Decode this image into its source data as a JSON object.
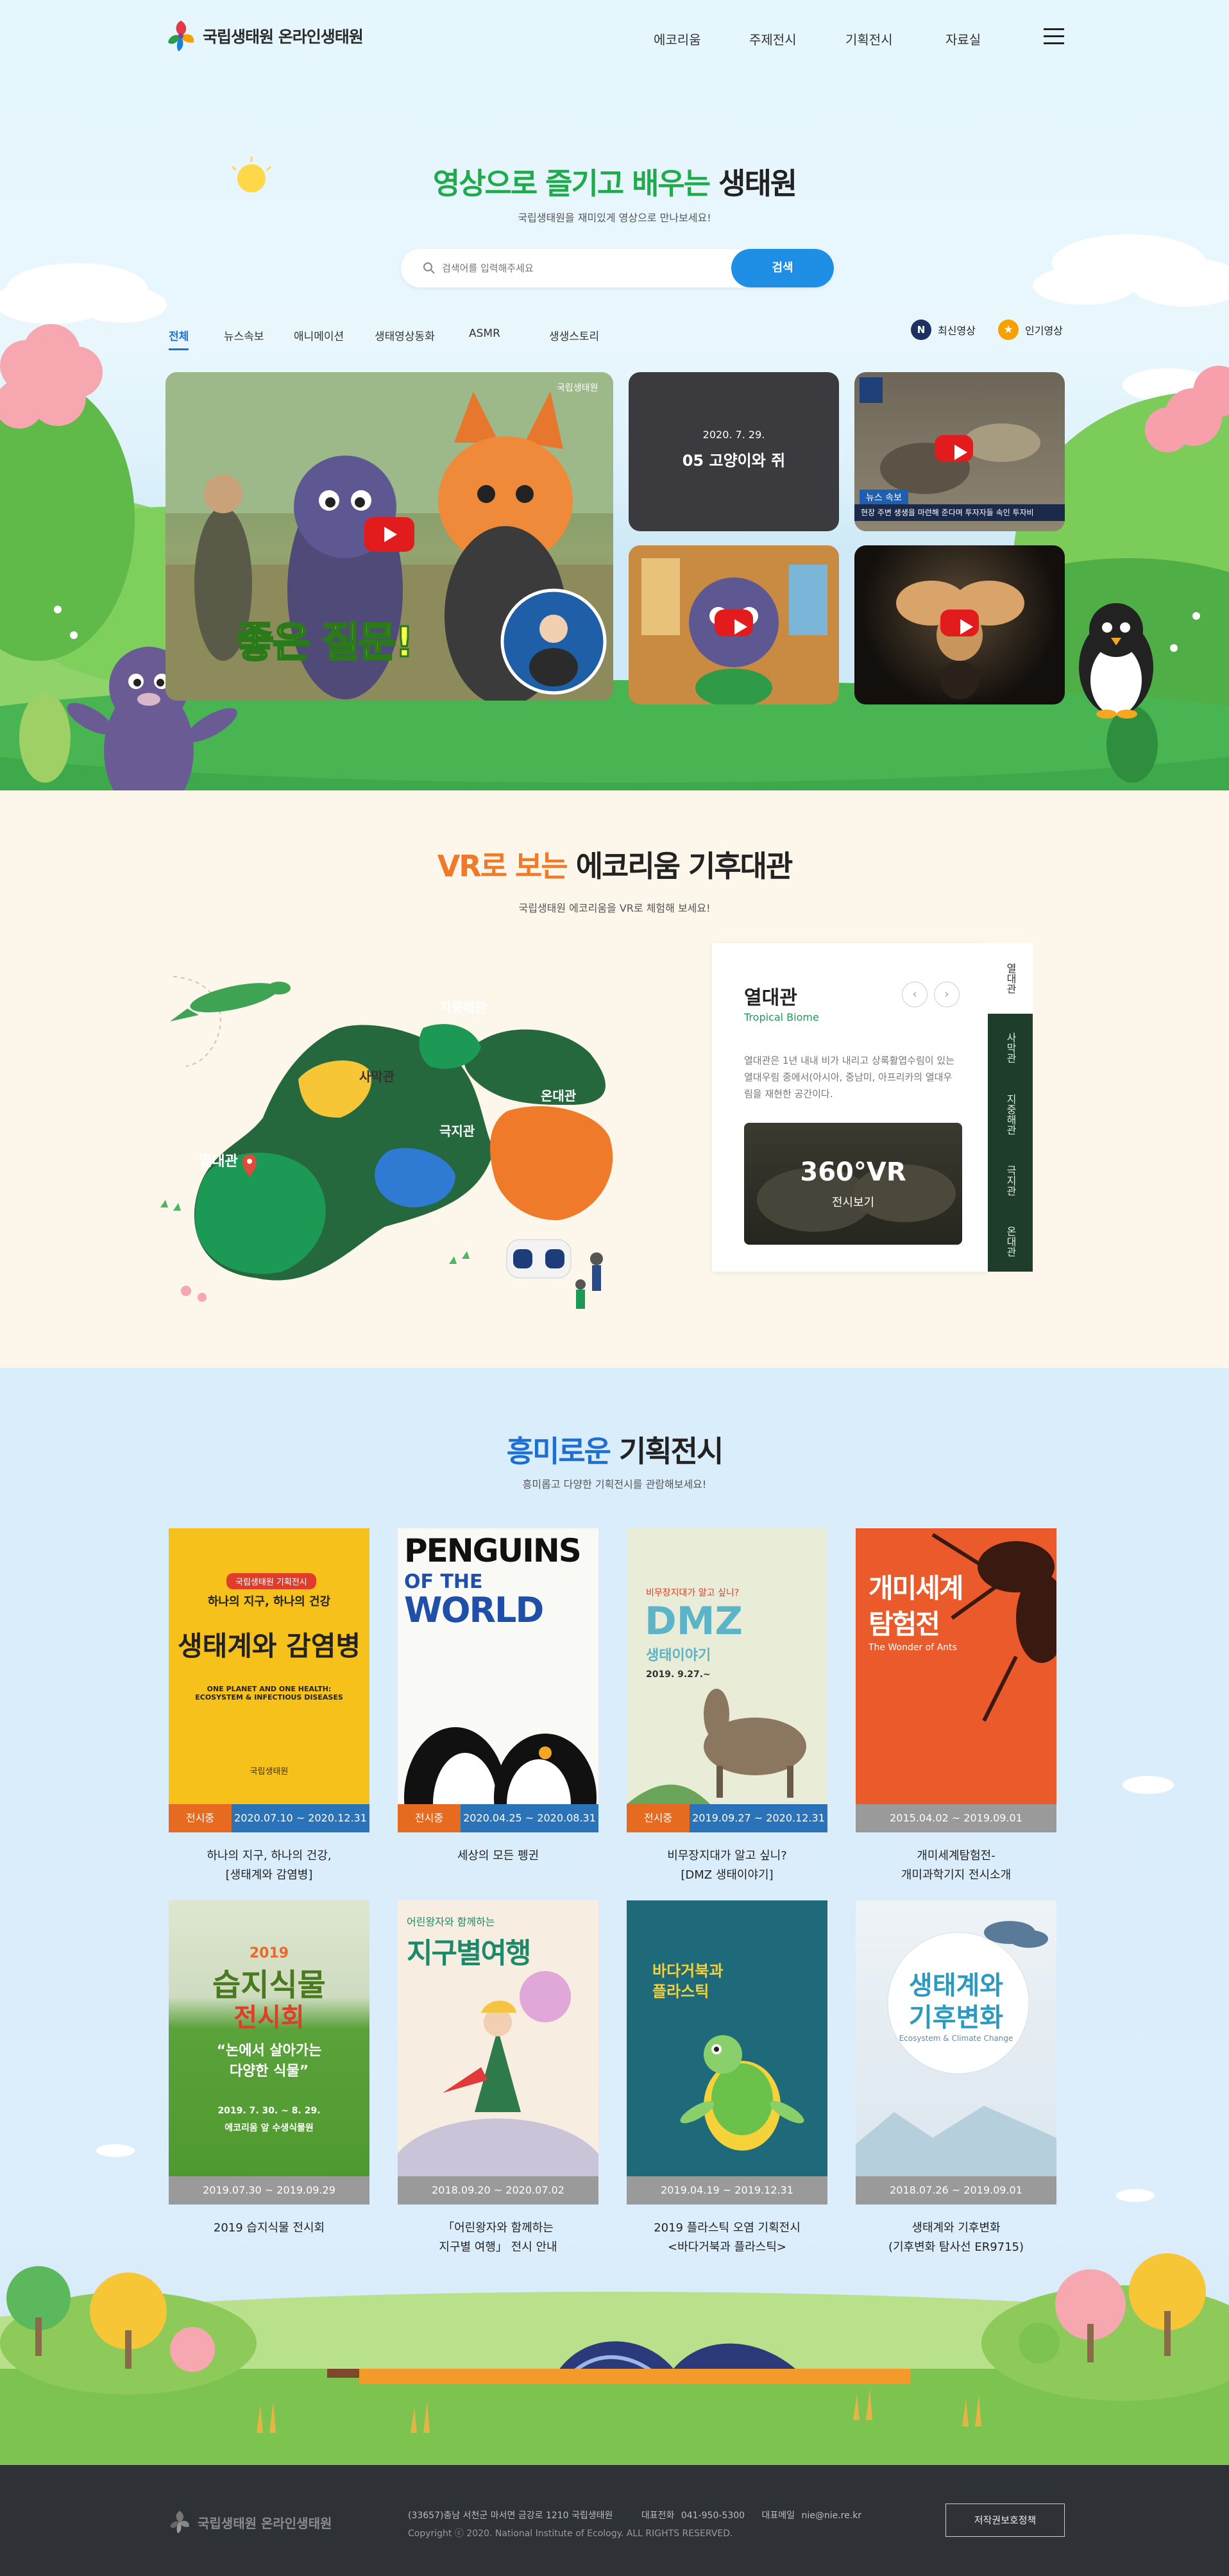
{
  "header": {
    "logo_text": "국립생태원 온라인생태원",
    "nav": [
      "에코리움",
      "주제전시",
      "기획전시",
      "자료실"
    ]
  },
  "video": {
    "title_highlight": "영상으로 즐기고 배우는",
    "title_rest": "생태원",
    "subtitle": "국립생태원을 재미있게 영상으로 만나보세요!",
    "search_placeholder": "검색어를 입력해주세요",
    "search_button": "검색",
    "tabs": [
      "전체",
      "뉴스속보",
      "애니메이션",
      "생태영상동화",
      "ASMR",
      "생생스토리"
    ],
    "sort_latest_badge": "N",
    "sort_latest": "최신영상",
    "sort_popular": "인기영상",
    "main_caption": "좋은 질문!",
    "main_watermark": "국립생태원",
    "card2_date": "2020. 7. 29.",
    "card2_title": "05 고양이와 쥐",
    "card3_tag": "뉴스 속보",
    "card3_caption": "현장 주변 생생을 마련해 준다며 투자자들 속인 투자비"
  },
  "vr": {
    "title_highlight": "VR로 보는",
    "title_rest": "에코리움 기후대관",
    "subtitle": "국립생태원 에코리움을 VR로 체험해 보세요!",
    "zones": [
      "지중해관",
      "사막관",
      "온대관",
      "극지관",
      "열대관"
    ],
    "panel_title": "열대관",
    "panel_en": "Tropical Biome",
    "panel_desc": "열대관은 1년 내내 비가 내리고 상록활엽수림이 있는 열대우림 중에서(아시아, 중남미, 아프리카의 열대우림을 재현한 공간이다.",
    "vr_button_big": "360°VR",
    "vr_button_small": "전시보기",
    "side_tabs": [
      "열대관",
      "사막관",
      "지중해관",
      "극지관",
      "온대관"
    ]
  },
  "exhibit": {
    "title_highlight": "흥미로운",
    "title_rest": "기획전시",
    "subtitle": "흥미롭고 다양한 기획전시를 관람해보세요!",
    "status_label": "전시중",
    "items": [
      {
        "date": "2020.07.10 ~ 2020.12.31",
        "caption1": "하나의 지구, 하나의 건강,",
        "caption2": "[생태계와 감염병]",
        "status": "전시중",
        "bar": "#2b73b8"
      },
      {
        "date": "2020.04.25 ~ 2020.08.31",
        "caption1": "세상의 모든 펭귄",
        "caption2": "",
        "status": "전시중",
        "bar": "#2b73b8"
      },
      {
        "date": "2019.09.27 ~ 2020.12.31",
        "caption1": "비무장지대가 알고 싶니?",
        "caption2": "[DMZ 생태이야기]",
        "status": "전시중",
        "bar": "#2b73b8"
      },
      {
        "date": "2015.04.02 ~ 2019.09.01",
        "caption1": "개미세계탐험전-",
        "caption2": "개미과학기지 전시소개",
        "status": "",
        "bar": "#9a9a9a"
      },
      {
        "date": "2019.07.30 ~ 2019.09.29",
        "caption1": "2019 습지식물 전시회",
        "caption2": "",
        "status": "",
        "bar": "#9a9a9a"
      },
      {
        "date": "2018.09.20 ~ 2020.07.02",
        "caption1": "「어린왕자와 함께하는",
        "caption2": "지구별 여행」 전시 안내",
        "status": "",
        "bar": "#9a9a9a"
      },
      {
        "date": "2019.04.19 ~ 2019.12.31",
        "caption1": "2019 플라스틱 오염 기획전시",
        "caption2": "<바다거북과 플라스틱>",
        "status": "",
        "bar": "#9a9a9a"
      },
      {
        "date": "2018.07.26 ~ 2019.09.01",
        "caption1": "생태계와 기후변화",
        "caption2": "(기후변화 탐사선 ER9715)",
        "status": "",
        "bar": "#9a9a9a"
      }
    ],
    "poster_texts": {
      "p1_top": "국립생태원 기획전시",
      "p1_head": "하나의 지구, 하나의 건강",
      "p1_big": "생태계와 감염병",
      "p1_en": "ONE PLANET AND ONE HEALTH: ECOSYSTEM & INFECTIOUS DISEASES",
      "p1_logo": "국립생태원",
      "p2_l1": "PENGUINS",
      "p2_l2": "OF THE",
      "p2_l3": "WORLD",
      "p3_small": "비무장지대가 알고 싶니?",
      "p3_big": "DMZ",
      "p3_sub": "생태이야기",
      "p3_date": "2019. 9.27.~",
      "p4_big1": "개미세계",
      "p4_big2": "탐험전",
      "p4_en": "The Wonder of Ants",
      "p5_year": "2019",
      "p5_big1": "습지식물",
      "p5_big2": "전시회",
      "p5_q1": "“논에서 살아가는",
      "p5_q2": "다양한 식물”",
      "p5_date": "2019. 7. 30. ~ 8. 29.",
      "p5_place": "에코리움 앞 수생식물원",
      "p6_small": "어린왕자와 함께하는",
      "p6_big": "지구별여행",
      "p7_big1": "바다거북과",
      "p7_big2": "플라스틱",
      "p8_big1": "생태계와",
      "p8_big2": "기후변화",
      "p8_en": "Ecosystem & Climate Change"
    }
  },
  "footer": {
    "logo_text": "국립생태원 온라인생태원",
    "address": "(33657)충남 서천군 마서면 금강로 1210 국립생태원",
    "tel_label": "대표전화",
    "tel": "041-950-5300",
    "email_label": "대표메일",
    "email": "nie@nie.re.kr",
    "copyright": "Copyright ⓒ 2020. National Institute of Ecology. ALL RIGHTS RESERVED.",
    "policy_button": "저작권보호정책"
  }
}
